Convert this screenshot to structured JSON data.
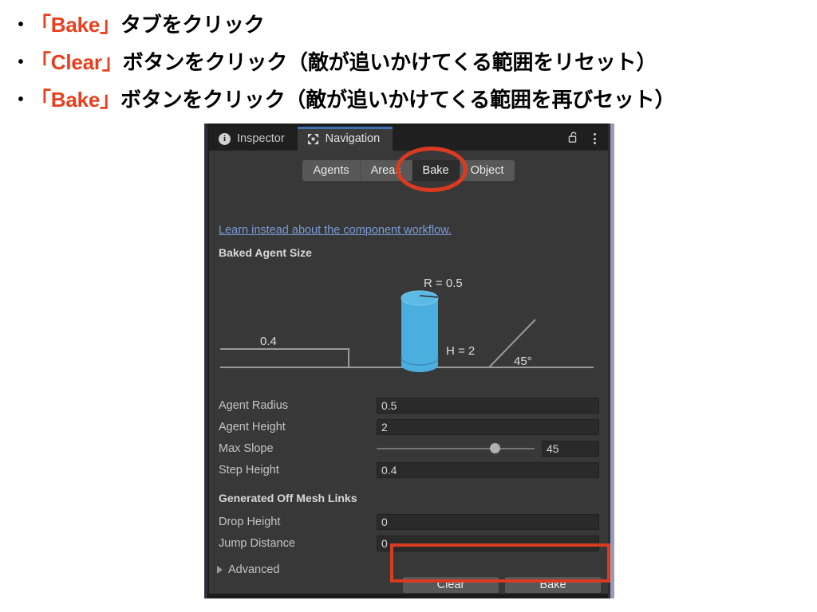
{
  "slide": {
    "bullets": [
      {
        "marker": "•",
        "quoted": "「Bake」",
        "rest": "タブをクリック"
      },
      {
        "marker": "•",
        "quoted": "「Clear」",
        "rest": "ボタンをクリック（敵が追いかけてくる範囲をリセット）"
      },
      {
        "marker": "•",
        "quoted": "「Bake」",
        "rest": "ボタンをクリック（敵が追いかけてくる範囲を再びセット）"
      }
    ],
    "highlight_color": "#E8401F"
  },
  "inspector": {
    "tabs": [
      {
        "label": "Inspector",
        "icon": "info-icon",
        "active": false
      },
      {
        "label": "Navigation",
        "icon": "navigation-move-icon",
        "active": true
      }
    ],
    "tools": {
      "lock": "lock-open-icon",
      "menu": "kebab-menu-icon"
    },
    "accent_color": "#3f6fb5"
  },
  "navigation": {
    "subtabs": [
      {
        "label": "Agents",
        "selected": false
      },
      {
        "label": "Areas",
        "selected": false
      },
      {
        "label": "Bake",
        "selected": true
      },
      {
        "label": "Object",
        "selected": false
      }
    ],
    "learn_link": "Learn instead about the component workflow.",
    "sections": {
      "baked_agent_size": "Baked Agent Size",
      "generated_off_mesh_links": "Generated Off Mesh Links"
    },
    "diagram": {
      "radius_label": "R = 0.5",
      "height_label": "H = 2",
      "step_label": "0.4",
      "slope_label": "45°",
      "agent_color": "#4aaede",
      "line_color": "#9a9a9a"
    },
    "properties": [
      {
        "label": "Agent Radius",
        "value": "0.5",
        "type": "text"
      },
      {
        "label": "Agent Height",
        "value": "2",
        "type": "text"
      },
      {
        "label": "Max Slope",
        "value": "45",
        "type": "slider",
        "slider_percent": 75
      },
      {
        "label": "Step Height",
        "value": "0.4",
        "type": "text"
      }
    ],
    "offmesh_properties": [
      {
        "label": "Drop Height",
        "value": "0",
        "type": "text"
      },
      {
        "label": "Jump Distance",
        "value": "0",
        "type": "text"
      }
    ],
    "advanced": {
      "label": "Advanced",
      "expanded": false
    },
    "buttons": [
      {
        "label": "Clear"
      },
      {
        "label": "Bake"
      }
    ]
  },
  "annotations": {
    "color": "#DA3B20",
    "ellipse_target": "Bake tab",
    "rect_target": "Clear and Bake buttons"
  }
}
